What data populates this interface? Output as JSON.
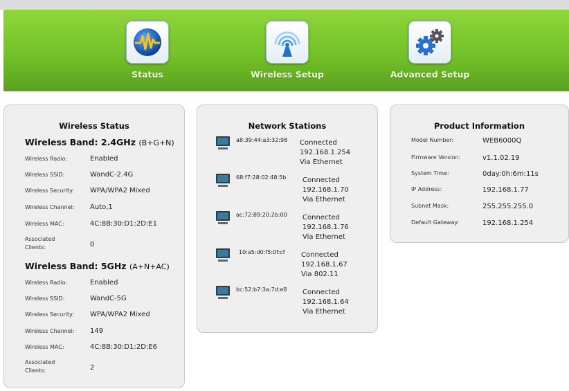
{
  "nav": {
    "items": [
      {
        "label": "Status",
        "icon": "status-wave-icon"
      },
      {
        "label": "Wireless Setup",
        "icon": "wireless-signal-icon"
      },
      {
        "label": "Advanced Setup",
        "icon": "gear-icon"
      }
    ]
  },
  "wireless_status": {
    "title": "Wireless Status",
    "band24": {
      "heading": "Wireless Band:",
      "value": "2.4GHz",
      "mode": "(B+G+N)",
      "rows": [
        {
          "label": "Wireless Radio:",
          "value": "Enabled"
        },
        {
          "label": "Wireless SSID:",
          "value": "WandC-2.4G"
        },
        {
          "label": "Wireless Security:",
          "value": "WPA/WPA2 Mixed"
        },
        {
          "label": "Wireless Channel:",
          "value": "Auto,1"
        },
        {
          "label": "Wireless MAC:",
          "value": "4C:8B:30:D1:2D:E1"
        },
        {
          "label": "Associated Clients:",
          "value": "0"
        }
      ]
    },
    "band5": {
      "heading": "Wireless Band:",
      "value": "5GHz",
      "mode": "(A+N+AC)",
      "rows": [
        {
          "label": "Wireless Radio:",
          "value": "Enabled"
        },
        {
          "label": "Wireless SSID:",
          "value": "WandC-5G"
        },
        {
          "label": "Wireless Security:",
          "value": "WPA/WPA2 Mixed"
        },
        {
          "label": "Wireless Channel:",
          "value": "149"
        },
        {
          "label": "Wireless MAC:",
          "value": "4C:8B:30:D1:2D:E6"
        },
        {
          "label": "Associated Clients:",
          "value": "2"
        }
      ]
    }
  },
  "network_stations": {
    "title": "Network Stations",
    "stations": [
      {
        "mac": "a8:39:44:a3:32:98",
        "status": "Connected",
        "ip": "192.168.1.254",
        "via": "Via Ethernet"
      },
      {
        "mac": "68:f7:28:02:48:5b",
        "status": "Connected",
        "ip": "192.168.1.70",
        "via": "Via Ethernet"
      },
      {
        "mac": "ac:72:89:20:2b:00",
        "status": "Connected",
        "ip": "192.168.1.76",
        "via": "Via Ethernet"
      },
      {
        "mac": "10:a5:d0:f5:0f:cf",
        "status": "Connected",
        "ip": "192.168.1.67",
        "via": "Via 802.11"
      },
      {
        "mac": "bc:52:b7:3a:7d:e8",
        "status": "Connected",
        "ip": "192.168.1.64",
        "via": "Via Ethernet"
      }
    ]
  },
  "product_info": {
    "title": "Product Information",
    "rows": [
      {
        "label": "Model Number:",
        "value": "WEB6000Q"
      },
      {
        "label": "Firmware Version:",
        "value": "v1.1.02.19"
      },
      {
        "label": "System Time:",
        "value": "0day:0h:6m:11s"
      },
      {
        "label": "IP Address:",
        "value": "192.168.1.77"
      },
      {
        "label": "Subnet Mask:",
        "value": "255.255.255.0"
      },
      {
        "label": "Default Gateway:",
        "value": "192.168.1.254"
      }
    ]
  },
  "colors": {
    "header_green": "#74c22a",
    "panel_bg": "#efefef"
  }
}
